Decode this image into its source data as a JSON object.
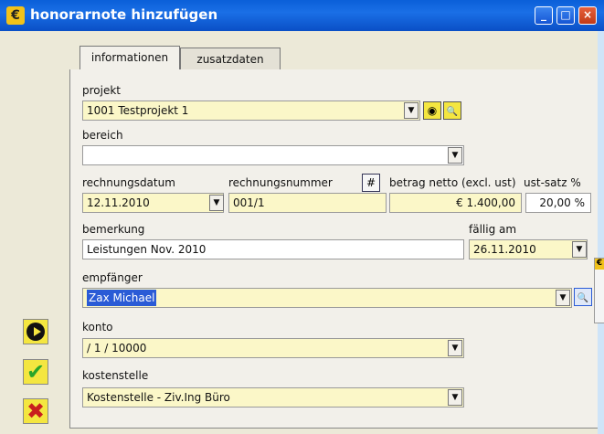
{
  "window": {
    "title": "honorarnote hinzufügen",
    "app_icon": "€",
    "controls": [
      "_",
      "□",
      "×"
    ]
  },
  "tabs": [
    {
      "label": "informationen",
      "active": true
    },
    {
      "label": "zusatzdaten",
      "active": false
    }
  ],
  "fields": {
    "projekt_label": "projekt",
    "projekt_value": "1001  Testprojekt 1",
    "bereich_label": "bereich",
    "bereich_value": "",
    "rechnungsdatum_label": "rechnungsdatum",
    "rechnungsdatum_value": "12.11.2010",
    "rechnungsnummer_label": "rechnungsnummer",
    "rechnungsnummer_value": "001/1",
    "hash_button": "#",
    "betrag_label": "betrag netto (excl. ust)",
    "betrag_value": "€ 1.400,00",
    "ust_label": "ust-satz %",
    "ust_value": "20,00 %",
    "bemerkung_label": "bemerkung",
    "bemerkung_value": "Leistungen Nov. 2010",
    "faellig_label": "fällig am",
    "faellig_value": "26.11.2010",
    "empfaenger_label": "empfänger",
    "empfaenger_value": "Zax Michael",
    "konto_label": "konto",
    "konto_value": "/ 1 / 10000",
    "kostenstelle_label": "kostenstelle",
    "kostenstelle_value": "Kostenstelle - Ziv.Ing Büro"
  },
  "icons": {
    "dropdown": "▼",
    "target": "◉",
    "search": "🔍",
    "check": "✔",
    "cross": "✖",
    "popup_icon": "€"
  },
  "colors": {
    "titlebar": "#0a5fd8",
    "field_yellow": "#fbf7c8",
    "button_yellow": "#f4e640",
    "selection": "#2a5bd6"
  }
}
